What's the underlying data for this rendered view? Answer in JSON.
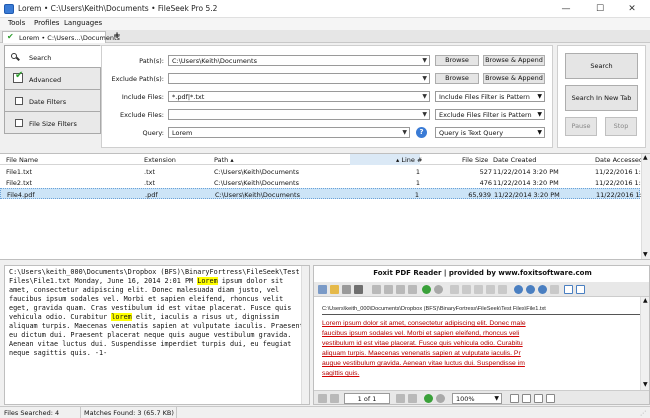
{
  "window": {
    "title": "Lorem • C:\\Users\\Keith\\Documents • FileSeek Pro 5.2",
    "minimize": "—",
    "maximize": "☐",
    "close": "✕"
  },
  "menu": [
    "Tools",
    "Profiles",
    "Languages"
  ],
  "tabs": {
    "active_label": "Lorem • C:\\Users...\\Documents",
    "new_tab": "+"
  },
  "sidebar": {
    "items": [
      {
        "label": "Search",
        "icon": "search-icon",
        "active": true
      },
      {
        "label": "Advanced",
        "icon": "checkbox-checked-icon",
        "checked": true
      },
      {
        "label": "Date Filters",
        "icon": "checkbox-icon",
        "checked": false
      },
      {
        "label": "File Size Filters",
        "icon": "checkbox-icon",
        "checked": false
      }
    ]
  },
  "form": {
    "path_label": "Path(s):",
    "path_value": "C:\\Users\\Keith\\Documents",
    "exclude_path_label": "Exclude Path(s):",
    "exclude_path_value": "",
    "include_files_label": "Include Files:",
    "include_files_value": "*.pdf|*.txt",
    "include_files_mode": "Include Files Filter is Pattern",
    "exclude_files_label": "Exclude Files:",
    "exclude_files_value": "",
    "exclude_files_mode": "Exclude Files Filter is Pattern",
    "query_label": "Query:",
    "query_value": "Lorem",
    "query_mode": "Query is Text Query",
    "help": "?",
    "browse": "Browse",
    "browse_append": "Browse & Append"
  },
  "actions": {
    "search": "Search",
    "search_new_tab": "Search In New Tab",
    "pause": "Pause",
    "stop": "Stop"
  },
  "results": {
    "columns": [
      "File Name",
      "Extension",
      "Path",
      "Line #",
      "File Size",
      "Date Created",
      "Date Accessed"
    ],
    "sort_path": "▴",
    "sort_line": "▴",
    "rows": [
      {
        "name": "File1.txt",
        "ext": ".txt",
        "path": "C:\\Users\\Keith\\Documents",
        "line": "1",
        "size": "527",
        "created": "11/22/2014 3:20 PM",
        "accessed": "11/22/2016 1:22 PM",
        "selected": false
      },
      {
        "name": "File2.txt",
        "ext": ".txt",
        "path": "C:\\Users\\Keith\\Documents",
        "line": "1",
        "size": "476",
        "created": "11/22/2014 3:20 PM",
        "accessed": "11/22/2016 1:22 PM",
        "selected": false
      },
      {
        "name": "File4.pdf",
        "ext": ".pdf",
        "path": "C:\\Users\\Keith\\Documents",
        "line": "1",
        "size": "65,939",
        "created": "11/22/2014 3:20 PM",
        "accessed": "11/22/2016 1:22 PM",
        "selected": true
      }
    ]
  },
  "preview": {
    "pre": "C:\\Users\\keith_000\\Documents\\Dropbox (BFS)\\BinaryFortress\\FileSeek\\Test Files\\File1.txt Monday, June 16, 2014 2:01 PM ",
    "hit1": "Lorem",
    "mid": " ipsum dolor sit amet, consectetur adipiscing elit. Donec malesuada diam justo, vel faucibus ipsum sodales vel. Morbi et sapien eleifend, rhoncus velit eget, gravida quam. Cras vestibulum id est vitae placerat. Fusce quis vehicula odio. Curabitur ",
    "hit2": "lorem",
    "post": " elit, iaculis a risus ut, dignissim aliquam turpis. Maecenas venenatis sapien at vulputate iaculis. Praesent eu dictum dui. Praesent placerat neque quis augue vestibulum gravida. Aenean vitae luctus dui. Suspendisse imperdiet turpis dui, eu feugiat neque sagittis quis. -1-"
  },
  "foxit": {
    "banner": "Foxit PDF Reader | provided by www.foxitsoftware.com",
    "doc_path": "C:\\Users\\keith_000\\Documents\\Dropbox (BFS)\\BinaryFortress\\FileSeek\\Test Files\\File1.txt",
    "lines": [
      "Lorem ipsum dolor sit amet, consectetur adipiscing elit. Donec male",
      "faucibus ipsum sodales vel. Morbi et sapien eleifend, rhoncus veli",
      "vestibulum id est vitae placerat. Fusce quis vehicula odio. Curabitu",
      "aliquam turpis. Maecenas venenatis sapien at vulputate iaculis. Pr",
      "augue vestibulum gravida. Aenean vitae luctus dui. Suspendisse im",
      "sagittis quis."
    ],
    "page_label": "1 of 1",
    "zoom": "100%",
    "accent": "#b30000"
  },
  "status": {
    "files_searched": "Files Searched: 4",
    "matches_found": "Matches Found: 3 (65.7 KB)"
  },
  "colors": {
    "accent": "#3a7bd5",
    "selection": "#cce4f7",
    "highlight": "#ffff00"
  }
}
